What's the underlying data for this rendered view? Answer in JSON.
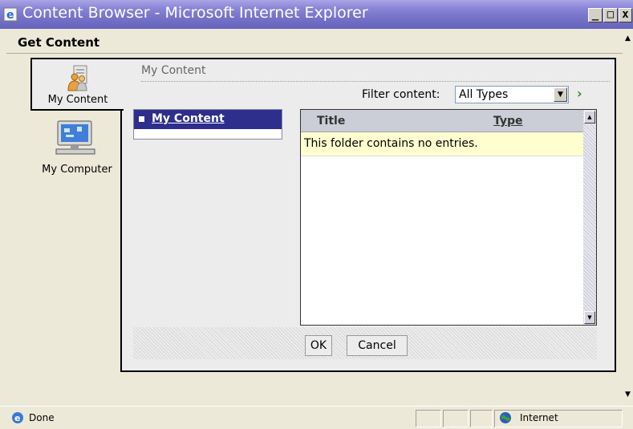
{
  "window": {
    "title": "Content Browser - Microsoft Internet Explorer",
    "minimize_label": "_",
    "maximize_label": "□",
    "close_label": "x"
  },
  "page": {
    "heading": "Get Content"
  },
  "tabs": [
    {
      "label": "My Content",
      "icon": "people-icon",
      "selected": true
    },
    {
      "label": "My Computer",
      "icon": "computer-icon",
      "selected": false
    }
  ],
  "breadcrumb": "My Content",
  "filter": {
    "label": "Filter content:",
    "selected": "All Types"
  },
  "tree": {
    "items": [
      {
        "label": "My Content",
        "selected": true
      }
    ]
  },
  "table": {
    "columns": [
      "Title",
      "Type"
    ],
    "empty_message": "This folder contains no entries."
  },
  "buttons": {
    "ok": "OK",
    "cancel": "Cancel"
  },
  "statusbar": {
    "status": "Done",
    "zone": "Internet"
  },
  "colors": {
    "titlebar": "#8884d6",
    "selection": "#2e2e8c",
    "empty_row": "#fffed0",
    "go_arrow": "#2e8b2e"
  }
}
